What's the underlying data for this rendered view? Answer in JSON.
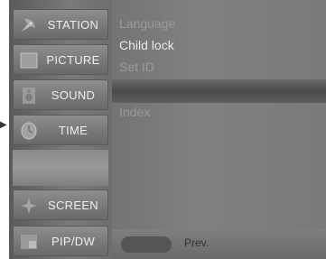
{
  "sidebar": {
    "items": [
      {
        "label": "STATION",
        "icon": "satellite-dish-icon"
      },
      {
        "label": "PICTURE",
        "icon": "picture-icon"
      },
      {
        "label": "SOUND",
        "icon": "sound-icon"
      },
      {
        "label": "TIME",
        "icon": "clock-icon"
      },
      {
        "label": "SCREEN",
        "icon": "screen-icon"
      },
      {
        "label": "PIP/DW",
        "icon": "pip-icon"
      }
    ]
  },
  "submenu": {
    "options": [
      {
        "label": "Language"
      },
      {
        "label": "Child lock"
      },
      {
        "label": "Set ID"
      },
      {
        "label": "Index"
      }
    ]
  },
  "footer": {
    "prev_label": "Prev."
  },
  "colors": {
    "osd_background": "#6f6f6f",
    "highlight_bar": "#4a4a4a",
    "text": "#eaeaea"
  }
}
